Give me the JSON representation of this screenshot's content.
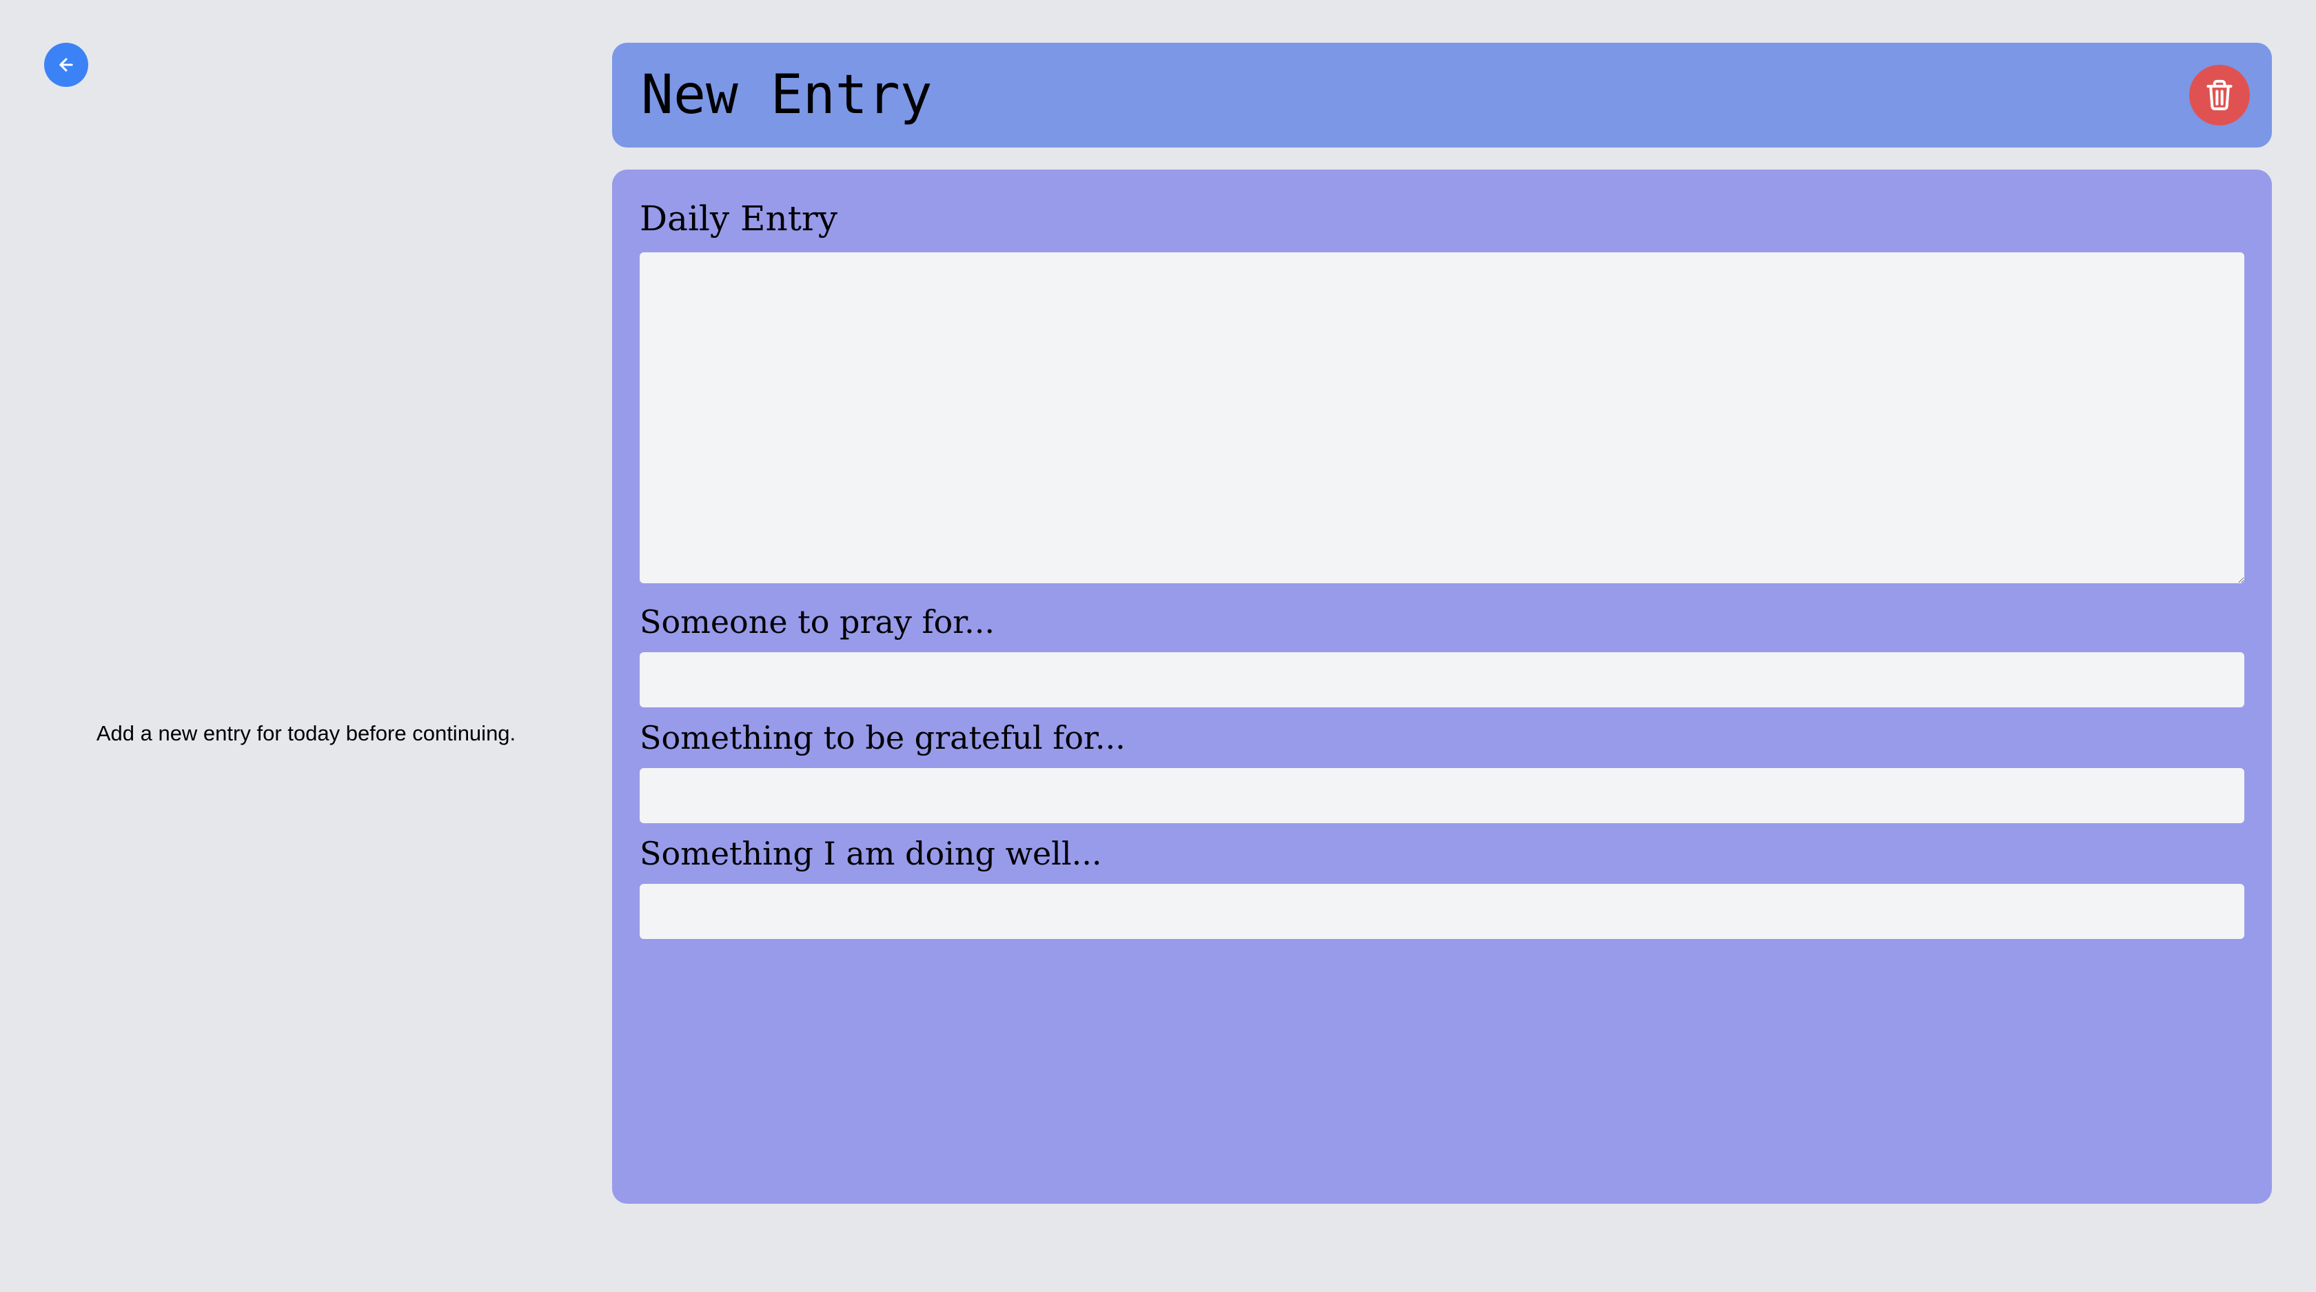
{
  "sidebar": {
    "back_icon": "arrow-left-icon",
    "message": "Add a new entry for today before continuing."
  },
  "header": {
    "title": "New Entry",
    "delete_icon": "trash-icon"
  },
  "form": {
    "daily_entry": {
      "label": "Daily Entry",
      "value": "",
      "placeholder": ""
    },
    "pray": {
      "label": "Someone to pray for...",
      "value": "",
      "placeholder": ""
    },
    "grateful": {
      "label": "Something to be grateful for...",
      "value": "",
      "placeholder": ""
    },
    "doing_well": {
      "label": "Something I am doing well...",
      "value": "",
      "placeholder": ""
    }
  },
  "colors": {
    "background": "#e5e7eb",
    "header": "#7b97e6",
    "form": "#989aea",
    "back_button": "#3b82f6",
    "delete_button": "#e05252",
    "input": "#f3f4f6"
  }
}
